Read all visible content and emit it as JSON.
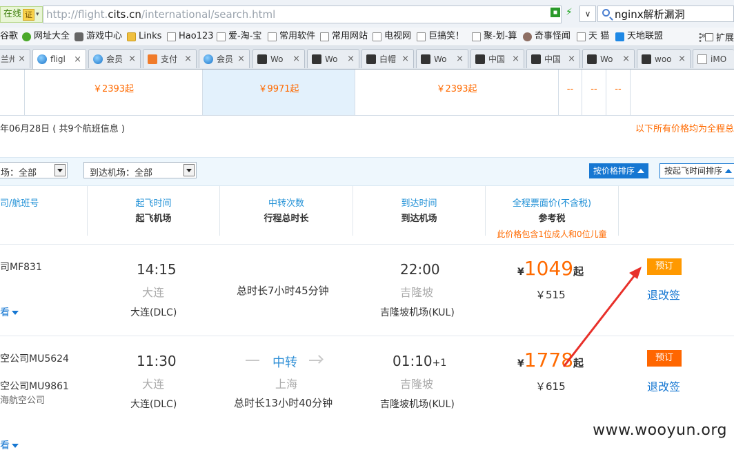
{
  "browser": {
    "online_label": "在线",
    "cert_label": "证",
    "url_prefix": "http://flight.",
    "url_host": "cits.cn",
    "url_path": "/international/search.html",
    "search_text": "nginx解析漏洞",
    "bookmarks": [
      "谷歌",
      "网址大全",
      "游戏中心",
      "Links",
      "Hao123",
      "爱-淘-宝",
      "常用软件",
      "常用网站",
      "电视网",
      "巨搞笑！",
      "聚-划-算",
      "奇事怪闻",
      "天 猫",
      "天地联盟"
    ],
    "bookmark_overflow": "»",
    "extension_label": "扩展",
    "tabs": [
      {
        "label": "兰州",
        "icon": "none"
      },
      {
        "label": "fligl",
        "icon": "globe",
        "active": true
      },
      {
        "label": "会员",
        "icon": "globe"
      },
      {
        "label": "支付",
        "icon": "shield"
      },
      {
        "label": "会员",
        "icon": "globe"
      },
      {
        "label": "Wo",
        "icon": "wooyun"
      },
      {
        "label": "Wo",
        "icon": "wooyun"
      },
      {
        "label": "白帽",
        "icon": "wooyun"
      },
      {
        "label": "Wo",
        "icon": "wooyun"
      },
      {
        "label": "中国",
        "icon": "wooyun"
      },
      {
        "label": "中国",
        "icon": "wooyun"
      },
      {
        "label": "Wo",
        "icon": "wooyun"
      },
      {
        "label": "woo",
        "icon": "wooyun"
      },
      {
        "label": "iMO",
        "icon": "page"
      }
    ],
    "tab_close": "×"
  },
  "price_strip": {
    "prices": [
      "￥2393起",
      "￥9971起",
      "￥2393起"
    ],
    "dashes": [
      "--",
      "--",
      "--"
    ]
  },
  "results": {
    "date_info": "年06月28日  ( 共9个航班信息 )",
    "price_note": "以下所有价格均为全程总",
    "filter_departure": "场：全部",
    "filter_arrival": "到达机场：全部",
    "sort_price": "按价格排序",
    "sort_time": "按起飞时间排序"
  },
  "table_header": {
    "col_flight": "司/航班号",
    "col_depart_l1": "起飞时间",
    "col_depart_l2": "起飞机场",
    "col_transfer_l1": "中转次数",
    "col_transfer_l2": "行程总时长",
    "col_arrive_l1": "到达时间",
    "col_arrive_l2": "到达机场",
    "col_price_l1": "全程票面价(不含税)",
    "col_price_l2": "参考税",
    "col_price_note": "此价格包含1位成人和0位儿童"
  },
  "flights": [
    {
      "flight_no_1": "司MF831",
      "detail_label": "看",
      "depart_time": "14:15",
      "depart_city": "大连",
      "depart_airport": "大连(DLC)",
      "duration": "总时长7小时45分钟",
      "arrive_time": "22:00",
      "arrive_city": "吉隆坡",
      "arrive_airport": "吉隆坡机场(KUL)",
      "yen": "¥",
      "price": "1049",
      "price_suffix": "起",
      "tax": "￥515",
      "book_label": "预订",
      "change_label": "退改签",
      "book_color": "#ff9900"
    },
    {
      "flight_no_1": "空公司MU5624",
      "flight_no_2": "空公司MU9861",
      "flight_op": "海航空公司",
      "detail_label": "看",
      "depart_time": "11:30",
      "depart_city": "大连",
      "depart_airport": "大连(DLC)",
      "transfer_label": "中转",
      "transfer_city": "上海",
      "duration": "总时长13小时40分钟",
      "arrive_time": "01:10",
      "arrive_plus": "+1",
      "arrive_city": "吉隆坡",
      "arrive_airport": "吉隆坡机场(KUL)",
      "yen": "¥",
      "price": "1778",
      "price_suffix": "起",
      "tax": "￥615",
      "book_label": "预订",
      "change_label": "退改签",
      "book_color": "#ff6600"
    }
  ],
  "watermark": "www.wooyun.org",
  "colors": {
    "accent_orange": "#ff6a00",
    "link_blue": "#1677d2",
    "annotation_red": "#e8302a"
  }
}
